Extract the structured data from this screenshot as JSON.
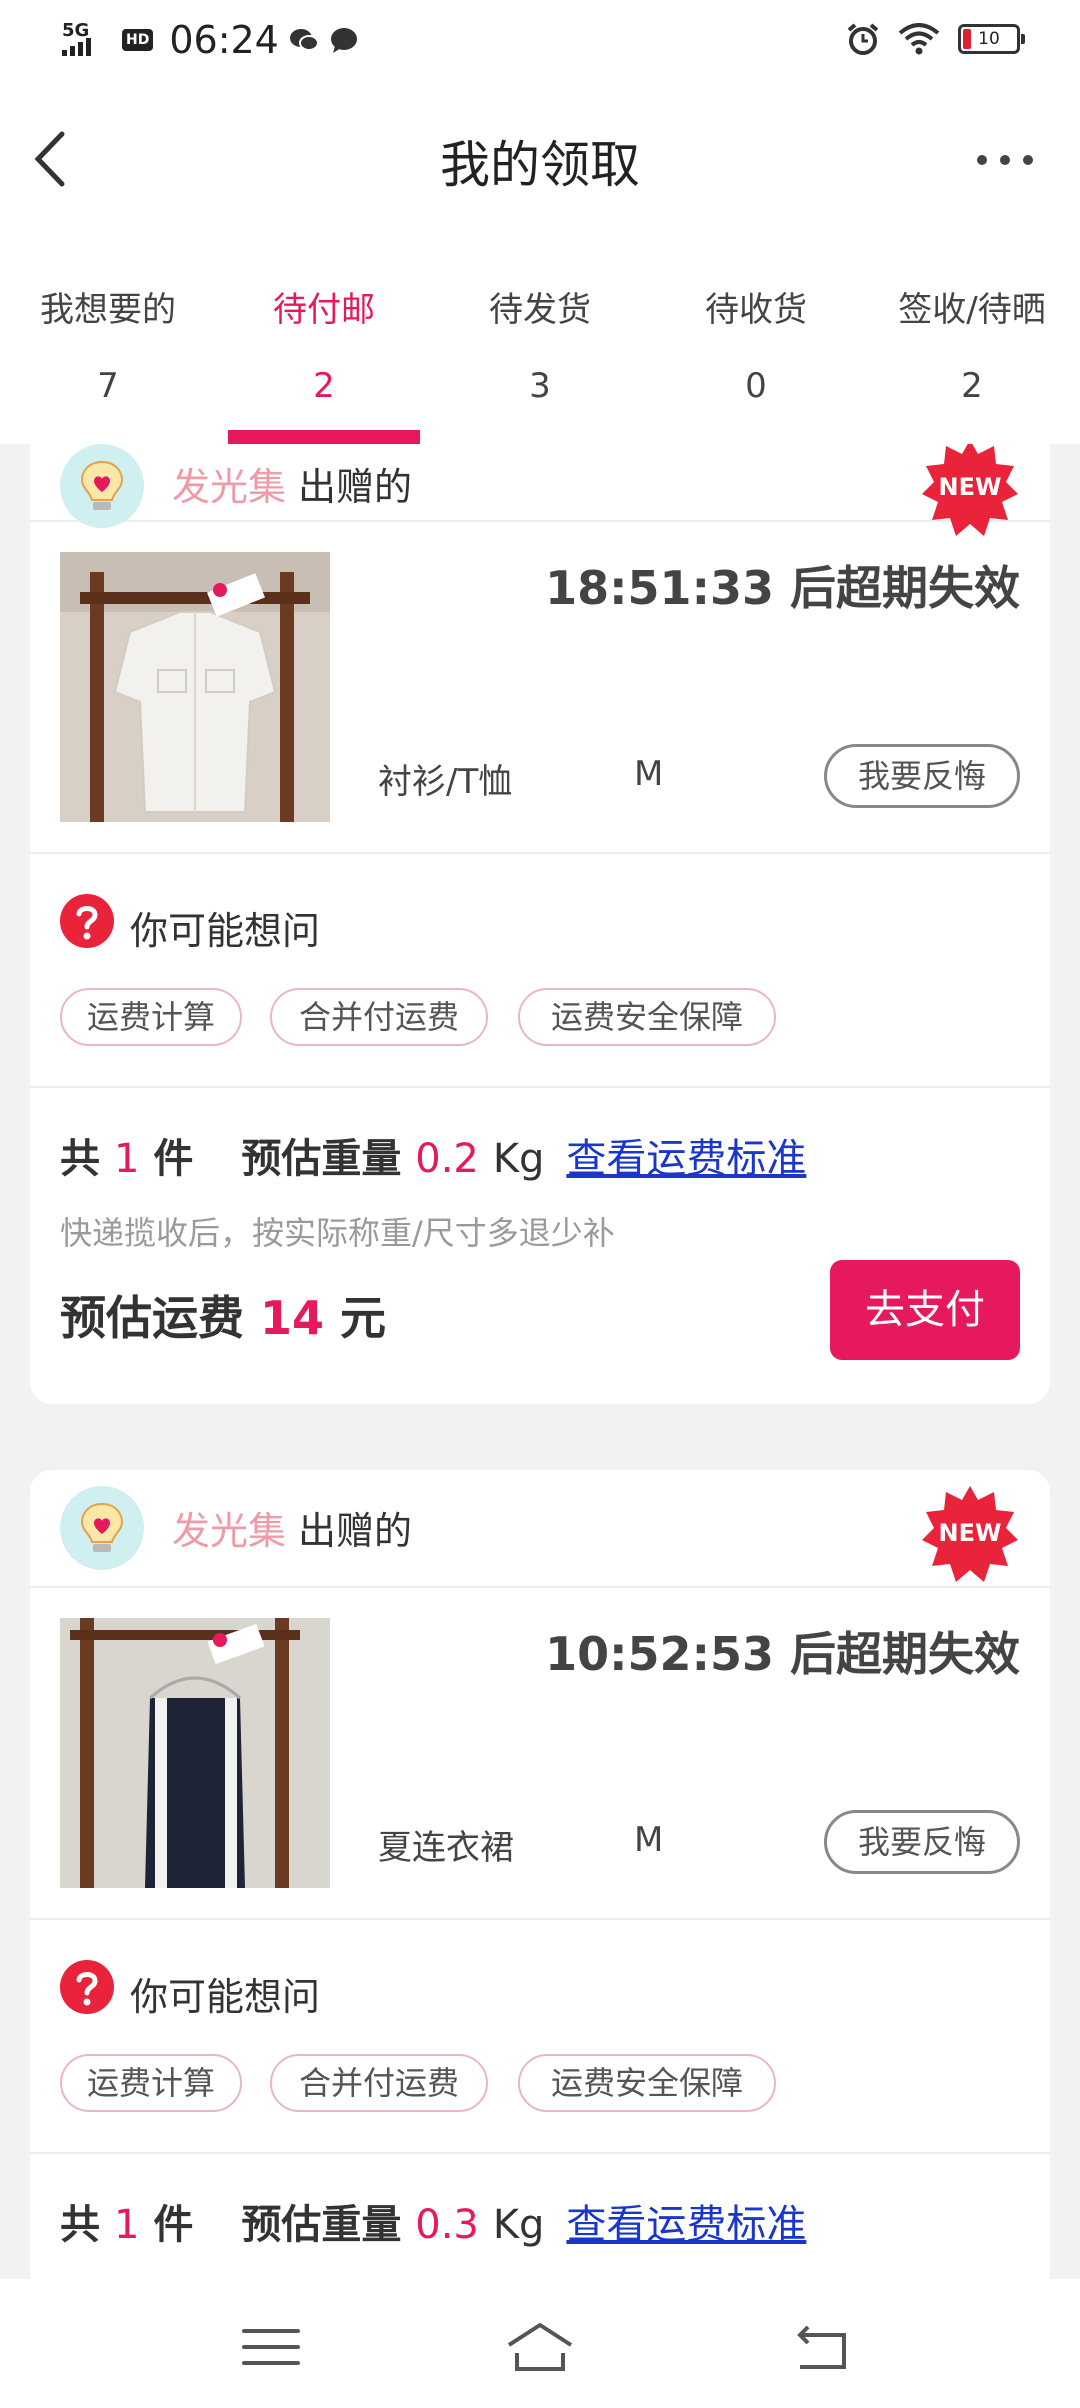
{
  "status_bar": {
    "network": "5G",
    "hd": "HD",
    "time": "06:24",
    "battery": "10"
  },
  "header": {
    "title": "我的领取"
  },
  "tabs": [
    {
      "label": "我想要的",
      "count": "7"
    },
    {
      "label": "待付邮",
      "count": "2"
    },
    {
      "label": "待发货",
      "count": "3"
    },
    {
      "label": "待收货",
      "count": "0"
    },
    {
      "label": "签收/待晒",
      "count": "2"
    }
  ],
  "active_tab": 1,
  "orders": [
    {
      "brand": "发光集",
      "sender_suffix": "出赠的",
      "badge": "NEW",
      "countdown": "18:51:33 后超期失效",
      "category": "衬衫/T恤",
      "size": "M",
      "regret_label": "我要反悔",
      "faq_title": "你可能想问",
      "faq_chips": [
        "运费计算",
        "合并付运费",
        "运费安全保障"
      ],
      "total_prefix": "共",
      "qty": "1",
      "qty_unit": "件",
      "weight_label": "预估重量",
      "weight": "0.2",
      "weight_unit": "Kg",
      "standard_link": "查看运费标准",
      "note": "快递揽收后，按实际称重/尺寸多退少补",
      "fee_label": "预估运费",
      "fee": "14",
      "fee_unit": "元",
      "pay_label": "去支付"
    },
    {
      "brand": "发光集",
      "sender_suffix": "出赠的",
      "badge": "NEW",
      "countdown": "10:52:53 后超期失效",
      "category": "夏连衣裙",
      "size": "M",
      "regret_label": "我要反悔",
      "faq_title": "你可能想问",
      "faq_chips": [
        "运费计算",
        "合并付运费",
        "运费安全保障"
      ],
      "total_prefix": "共",
      "qty": "1",
      "qty_unit": "件",
      "weight_label": "预估重量",
      "weight": "0.3",
      "weight_unit": "Kg",
      "standard_link": "查看运费标准"
    }
  ],
  "colors": {
    "accent": "#e5195b",
    "brand_text": "#ef9aa6",
    "link": "#1a37c9",
    "background": "#f2f2f2"
  }
}
